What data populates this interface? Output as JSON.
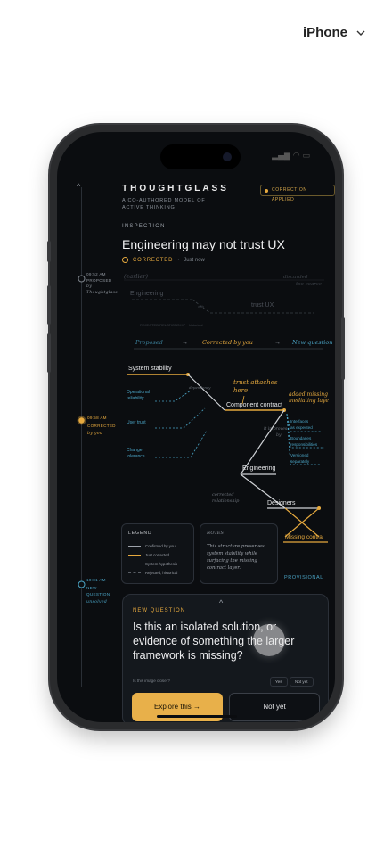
{
  "device_selector": {
    "label": "iPhone",
    "icon": "chevron-down-icon"
  },
  "app": {
    "brand": "THOUGHTGLASS",
    "tagline": "A CO-AUTHORED MODEL OF ACTIVE THINKING",
    "badge": "CORRECTION APPLIED",
    "section_label": "INSPECTION",
    "title": "Engineering may not trust UX",
    "status": "CORRECTED",
    "status_time": "Just now"
  },
  "timeline": {
    "nodes": [
      {
        "time": "09:52 AM",
        "state": "PROPOSED",
        "by": "by",
        "author": "Thoughtglass"
      },
      {
        "time": "09:58 AM",
        "state": "CORRECTED",
        "by": "by you",
        "author": ""
      },
      {
        "time": "10:01 AM",
        "state": "NEW",
        "state2": "QUESTION",
        "by": "unsolved",
        "author": ""
      }
    ]
  },
  "earlier": {
    "label": "(earlier)",
    "engineering": "Engineering",
    "trust_ux": "trust UX",
    "discarded": "discarded",
    "discarded2": "too coarse",
    "rejected": "REJECTED RELATIONSHIP · historical",
    "with_label": "with"
  },
  "flow": {
    "proposed": "Proposed",
    "arrow": "→",
    "corrected": "Corrected by you",
    "new_question": "New question"
  },
  "graph": {
    "system_stability": "System stability",
    "operational": "Operational",
    "reliability": "reliability",
    "user_trust": "User trust",
    "change": "Change",
    "tolerance": "tolerance",
    "dependency": "dependency",
    "component_contract": "Component contract",
    "trust_attaches": "trust attaches",
    "here": "here",
    "added_missing": "added missing",
    "mediating_layer": "mediating laye",
    "interfaces": "Interfaces",
    "as_expected": "as expected",
    "boundaries": "Boundaries",
    "responsibilities": "responsibilities",
    "versioned": "Versioned",
    "separately": "separately",
    "it_improves": "it improves",
    "by": "by",
    "engineering": "Engineering",
    "corrected_rel": "corrected",
    "relationship": "relationship",
    "designers": "Designers",
    "missing_contract": "Missing contra"
  },
  "legend": {
    "title": "LEGEND",
    "items": [
      {
        "label": "Confirmed by you",
        "color": "#9ea3ab"
      },
      {
        "label": "Just corrected",
        "color": "#e6a93e"
      },
      {
        "label": "System hypothesis",
        "color": "#4aa3c4"
      },
      {
        "label": "Rejected, historical",
        "color": "#5a5f66"
      }
    ]
  },
  "notes": {
    "title": "NOTES",
    "body": "This structure preserves system stability while surfacing the missing contract layer."
  },
  "provisional": "PROVISIONAL",
  "question_card": {
    "label": "NEW QUESTION",
    "question": "Is this an isolated solution, or evidence of something the larger framework is missing?",
    "hint": "Is this image closer?",
    "chip_yes": "Yes",
    "chip_not_yet": "Not yet",
    "primary": "Explore this →",
    "secondary": "Not yet"
  },
  "colors": {
    "accent": "#e6a93e",
    "hypothesis": "#4aa3c4",
    "bg": "#0b0d10"
  }
}
